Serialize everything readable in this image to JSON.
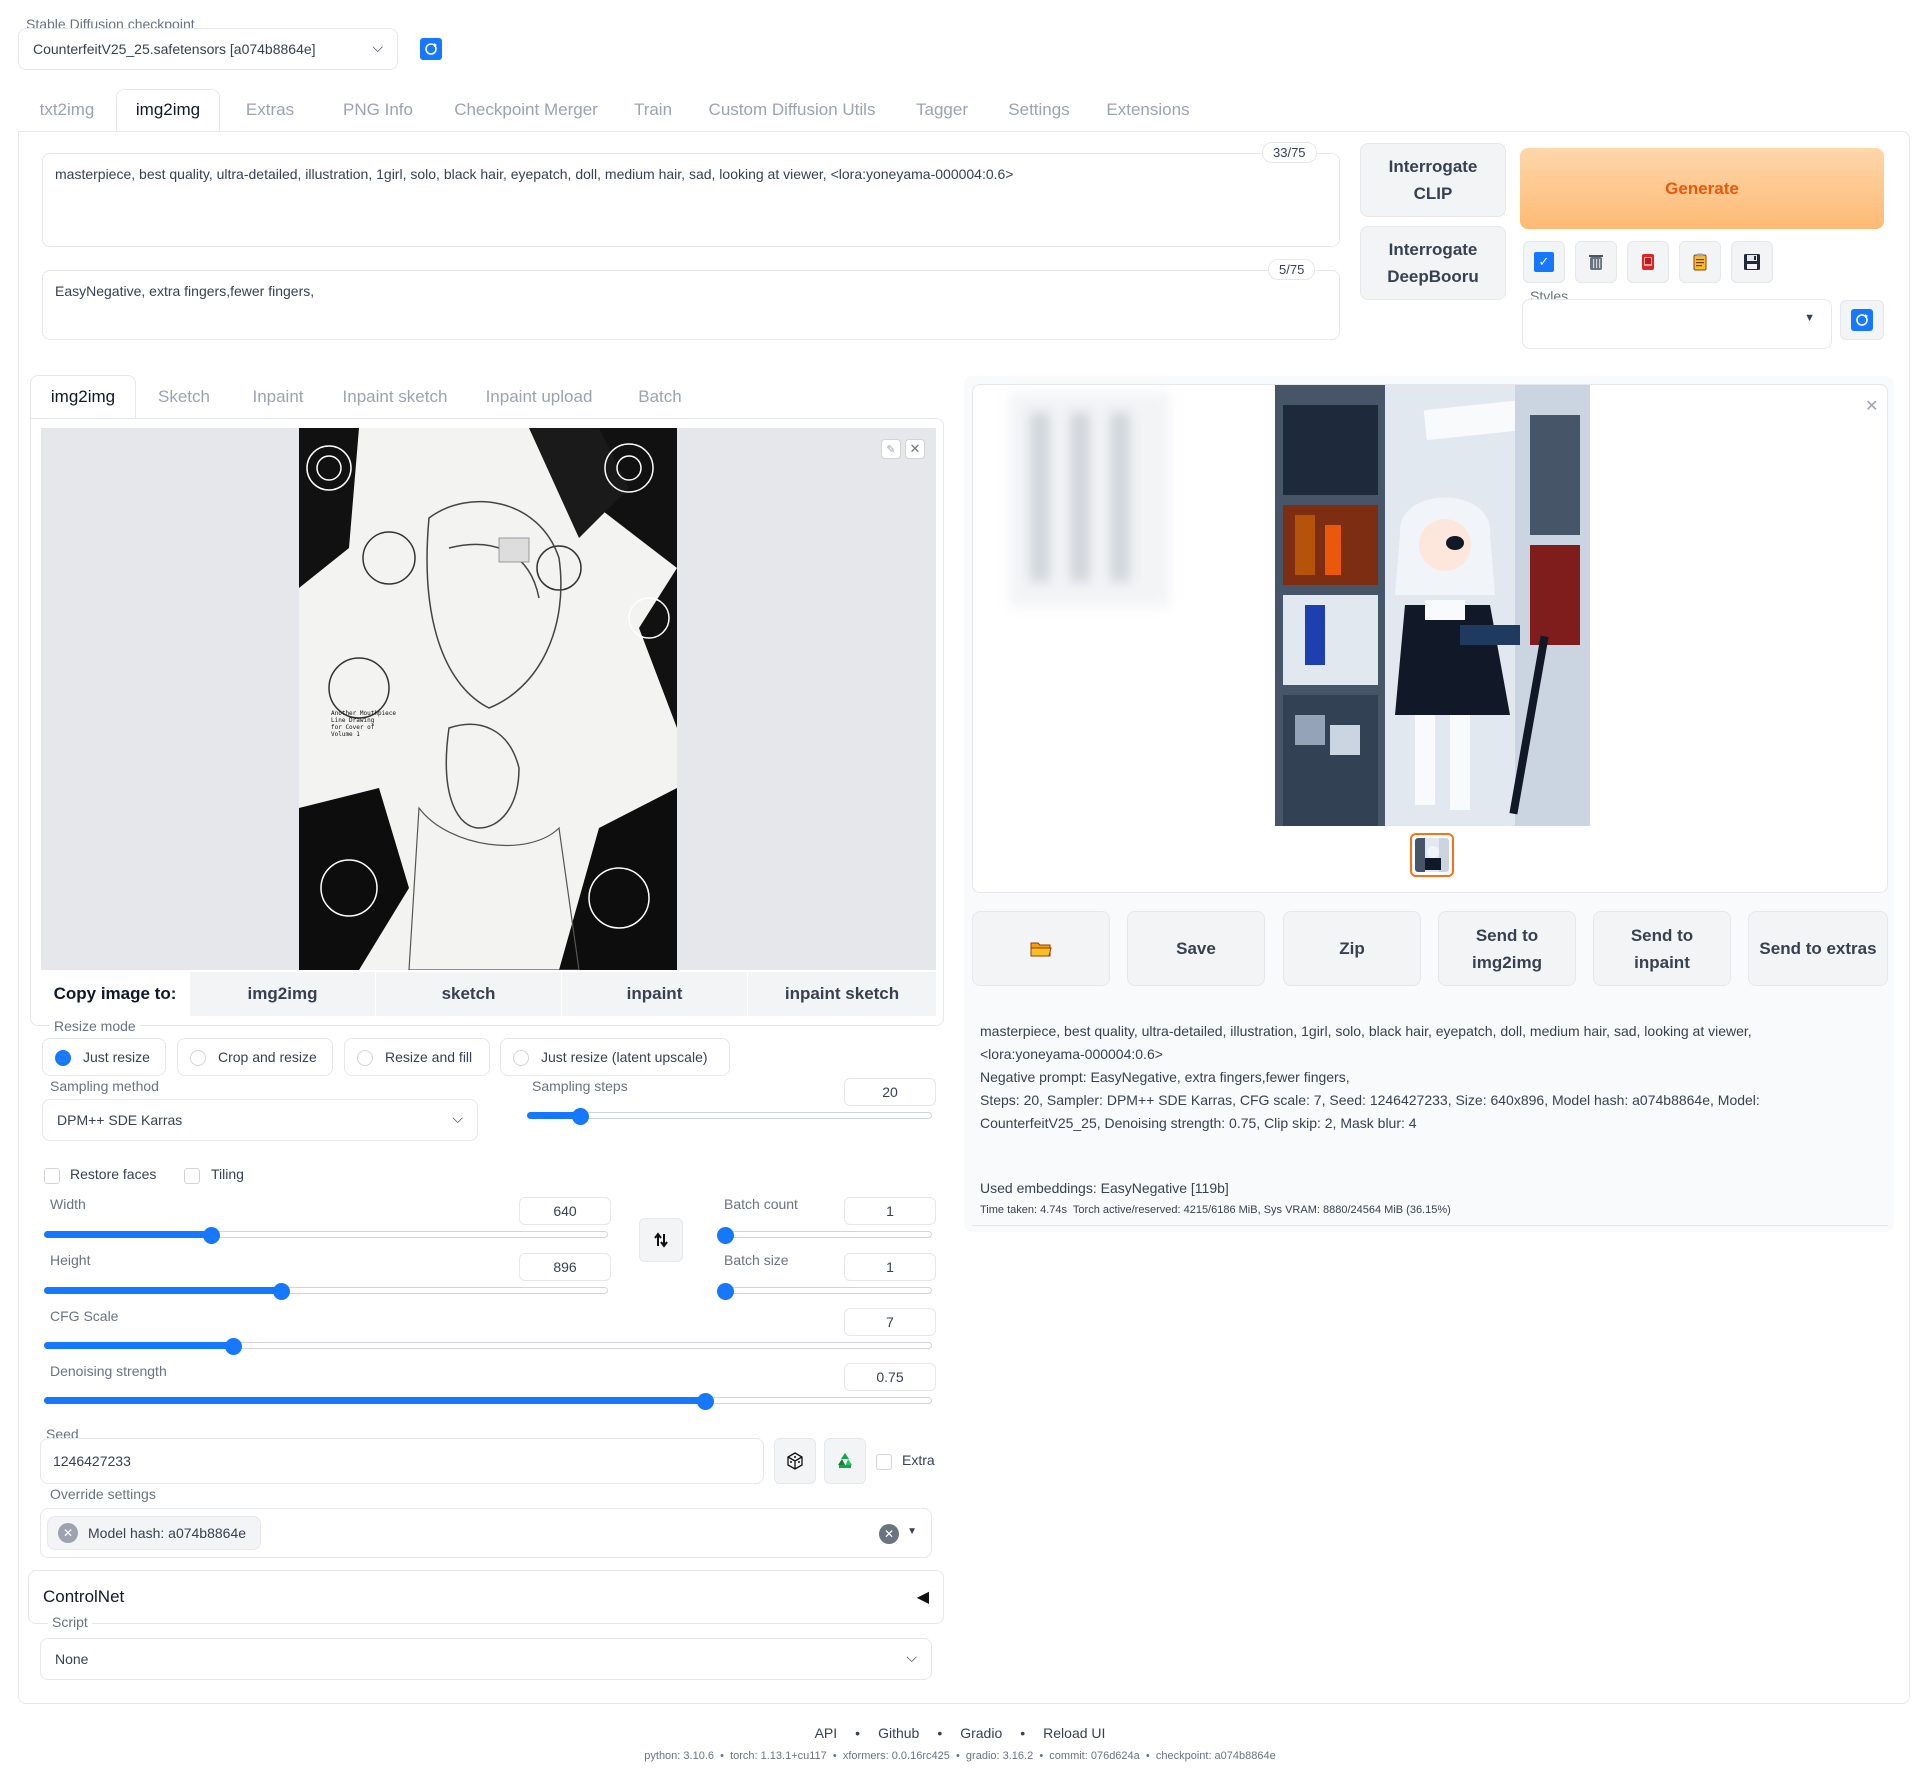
{
  "checkpoint": {
    "label": "Stable Diffusion checkpoint",
    "value": "CounterfeitV25_25.safetensors [a074b8864e]"
  },
  "main_tabs": [
    "txt2img",
    "img2img",
    "Extras",
    "PNG Info",
    "Checkpoint Merger",
    "Train",
    "Custom Diffusion Utils",
    "Tagger",
    "Settings",
    "Extensions"
  ],
  "main_tab_selected": "img2img",
  "prompt": {
    "text": "masterpiece, best quality, ultra-detailed, illustration, 1girl, solo, black hair, eyepatch, doll, medium hair, sad, looking at viewer,  <lora:yoneyama-000004:0.6>",
    "counter": "33/75"
  },
  "negative_prompt": {
    "text": "EasyNegative, extra fingers,fewer fingers,",
    "counter": "5/75"
  },
  "interrogate": {
    "clip": "Interrogate CLIP",
    "deepbooru": "Interrogate DeepBooru"
  },
  "generate_label": "Generate",
  "styles_label": "Styles",
  "sub_tabs": [
    "img2img",
    "Sketch",
    "Inpaint",
    "Inpaint sketch",
    "Inpaint upload",
    "Batch"
  ],
  "sub_tab_selected": "img2img",
  "input_image_text": "Another Mouthpiece\nLine Drawing\nfor Cover of\nVolume 1",
  "copy_image": {
    "label": "Copy image to:",
    "targets": [
      "img2img",
      "sketch",
      "inpaint",
      "inpaint sketch"
    ]
  },
  "resize_mode": {
    "label": "Resize mode",
    "options": [
      "Just resize",
      "Crop and resize",
      "Resize and fill",
      "Just resize (latent upscale)"
    ],
    "selected": "Just resize"
  },
  "sampling_method": {
    "label": "Sampling method",
    "value": "DPM++ SDE Karras"
  },
  "sampling_steps": {
    "label": "Sampling steps",
    "value": "20",
    "min": 1,
    "max": 150,
    "fraction": 0.13
  },
  "restore_faces": {
    "label": "Restore faces",
    "checked": false
  },
  "tiling": {
    "label": "Tiling",
    "checked": false
  },
  "width": {
    "label": "Width",
    "value": "640",
    "fraction": 0.295
  },
  "height": {
    "label": "Height",
    "value": "896",
    "fraction": 0.42
  },
  "batch_count": {
    "label": "Batch count",
    "value": "1",
    "fraction": 0
  },
  "batch_size": {
    "label": "Batch size",
    "value": "1",
    "fraction": 0
  },
  "cfg_scale": {
    "label": "CFG Scale",
    "value": "7",
    "fraction": 0.212
  },
  "denoising": {
    "label": "Denoising strength",
    "value": "0.75",
    "fraction": 0.745
  },
  "seed": {
    "label": "Seed",
    "value": "1246427233",
    "extra_label": "Extra"
  },
  "override": {
    "label": "Override settings",
    "chip": "Model hash: a074b8864e"
  },
  "controlnet": {
    "label": "ControlNet",
    "arrow": "◀"
  },
  "script": {
    "label": "Script",
    "value": "None"
  },
  "output_buttons": {
    "folder": "📂",
    "save": "Save",
    "zip": "Zip",
    "send_img2img": "Send to img2img",
    "send_inpaint": "Send to inpaint",
    "send_extras": "Send to extras"
  },
  "info": {
    "line1": "masterpiece, best quality, ultra-detailed, illustration, 1girl, solo, black hair, eyepatch, doll, medium hair, sad, looking at viewer,",
    "line2": "<lora:yoneyama-000004:0.6>",
    "line3": "Negative prompt: EasyNegative, extra fingers,fewer fingers,",
    "line4": "Steps: 20, Sampler: DPM++ SDE Karras, CFG scale: 7, Seed: 1246427233, Size: 640x896, Model hash: a074b8864e, Model:",
    "line5": "CounterfeitV25_25, Denoising strength: 0.75, Clip skip: 2, Mask blur: 4",
    "embeddings": "Used embeddings: EasyNegative [119b]",
    "time": "Time taken: 4.74s  Torch active/reserved: 4215/6186 MiB, Sys VRAM: 8880/24564 MiB (36.15%)"
  },
  "footer": {
    "links": [
      "API",
      "Github",
      "Gradio",
      "Reload UI"
    ],
    "versions": "python: 3.10.6  •  torch: 1.13.1+cu117  •  xformers: 0.0.16rc425  •  gradio: 3.16.2  •  commit: 076d624a  •  checkpoint: a074b8864e"
  },
  "colors": {
    "accent": "#1677ff",
    "generate_bg": "#fdba74",
    "generate_text": "#ea580c",
    "gallery_selected": "#f97316"
  }
}
